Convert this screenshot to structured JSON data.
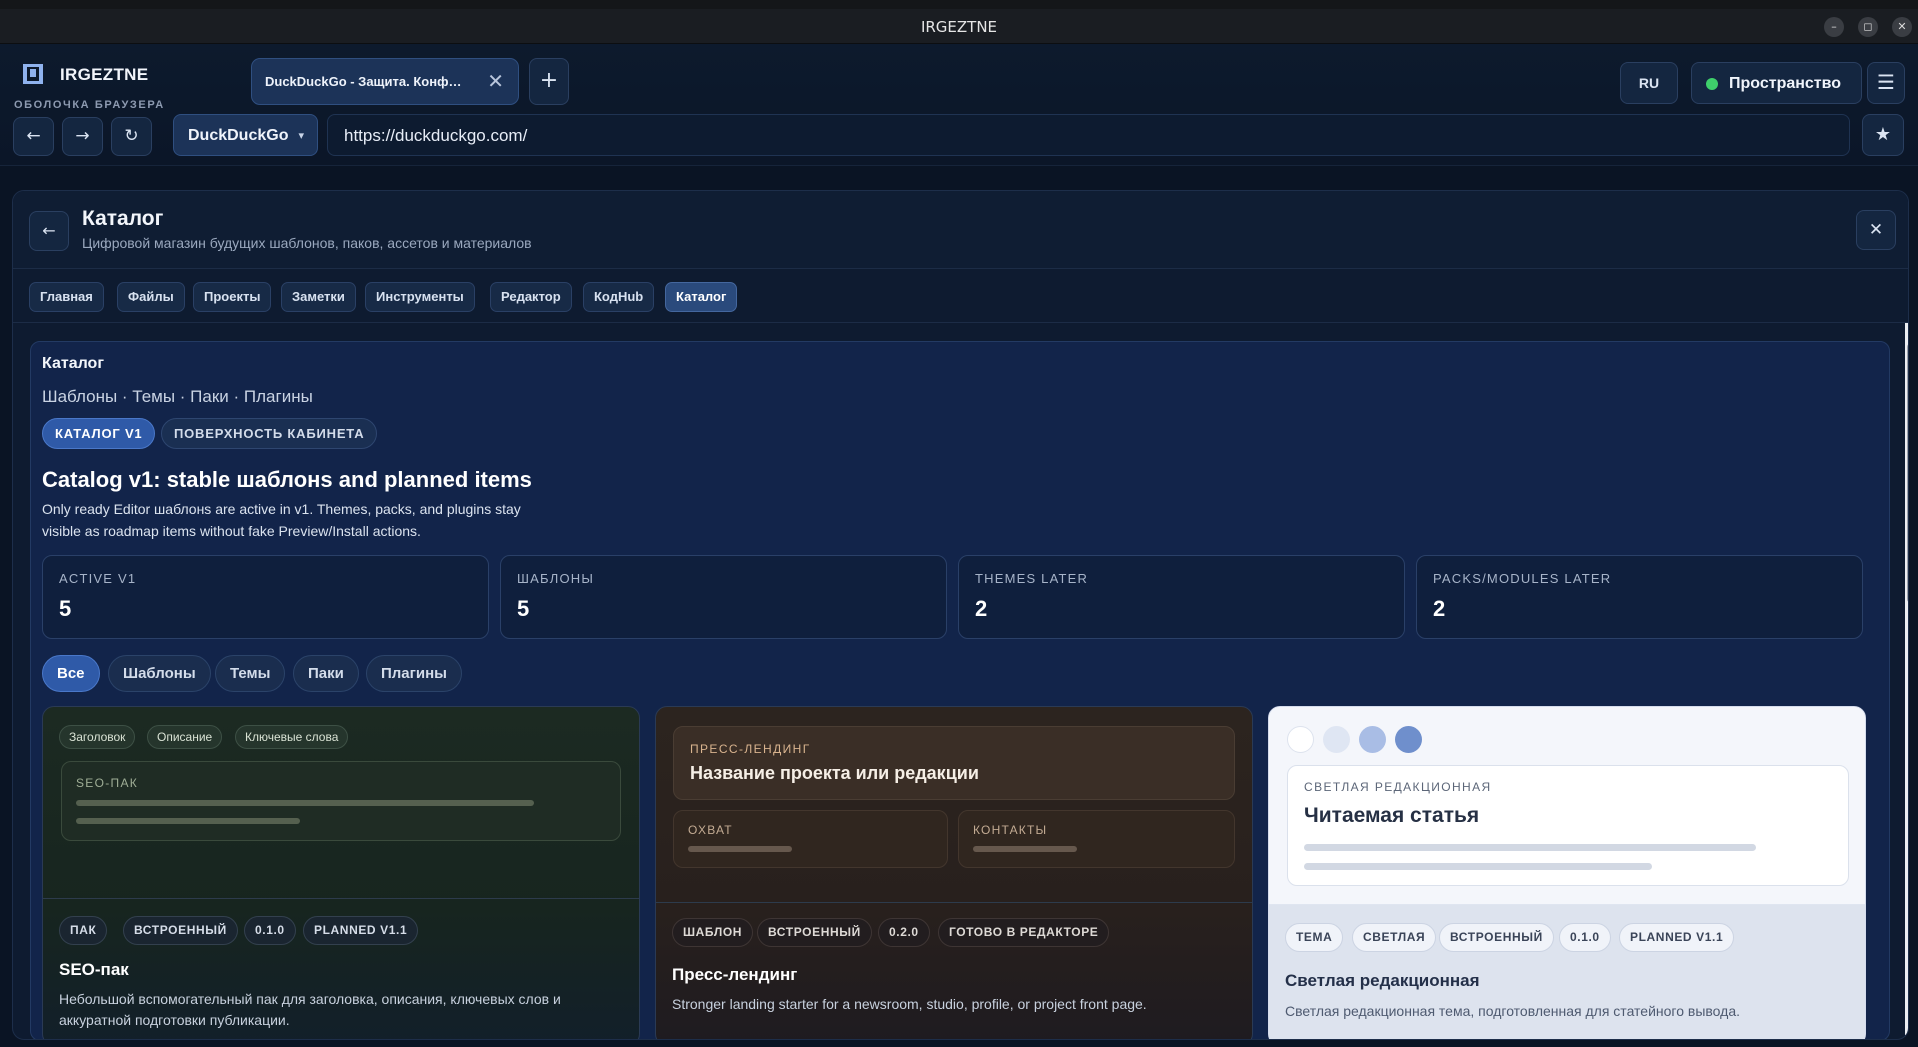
{
  "os": {
    "title": "IRGEZTNE",
    "minimize": "–",
    "maximize": "◻",
    "close": "✕"
  },
  "brand": {
    "name": "IRGEZTNE",
    "subtitle": "ОБОЛОЧКА БРАУЗЕРА"
  },
  "tabs": [
    {
      "label": "DuckDuckGo - Защита. Конф…",
      "close": "✕"
    }
  ],
  "new_tab": "+",
  "toolbar": {
    "lang": "RU",
    "space": "Пространство",
    "menu": "☰",
    "back": "←",
    "forward": "→",
    "reload": "↻",
    "engine": "DuckDuckGo",
    "engine_caret": "▾",
    "url": "https://duckduckgo.com/",
    "bookmark": "★"
  },
  "colors": {
    "accent": "#2f5aa8",
    "status_online": "#3ecf6b",
    "panel_bg": "#0e1b30"
  },
  "panel": {
    "back": "←",
    "title": "Каталог",
    "subtitle": "Цифровой магазин будущих шаблонов, паков, ассетов и материалов",
    "close": "✕",
    "nav": [
      "Главная",
      "Файлы",
      "Проекты",
      "Заметки",
      "Инструменты",
      "Редактор",
      "КодHub",
      "Каталог"
    ],
    "nav_active": "Каталог"
  },
  "catalog": {
    "title": "Каталог",
    "crumbs": "Шаблоны · Темы · Паки · Плагины",
    "chip_primary": "КАТАЛОГ V1",
    "chip_secondary": "ПОВЕРХНОСТЬ КАБИНЕТА",
    "heading": "Catalog v1: stable шаблонs and planned items",
    "description": "Only ready Editor шаблонs are active in v1. Themes, packs, and plugins stay visible as roadmap items without fake Preview/Install actions.",
    "stats": [
      {
        "label": "ACTIVE V1",
        "value": "5"
      },
      {
        "label": "ШАБЛОНЫ",
        "value": "5"
      },
      {
        "label": "THEMES LATER",
        "value": "2"
      },
      {
        "label": "PACKS/MODULES LATER",
        "value": "2"
      }
    ],
    "filters": [
      "Все",
      "Шаблоны",
      "Темы",
      "Паки",
      "Плагины"
    ],
    "filter_active": "Все",
    "cards": [
      {
        "preview_tags": [
          "Заголовок",
          "Описание",
          "Ключевые слова"
        ],
        "preview_label": "SEO-ПАК",
        "tags": [
          "ПАК",
          "ВСТРОЕННЫЙ",
          "0.1.0",
          "PLANNED V1.1"
        ],
        "name": "SEO-пак",
        "description": "Небольшой вспомогательный пак для заголовка, описания, ключевых слов и аккуратной подготовки публикации."
      },
      {
        "preview_kicker": "ПРЕСС-ЛЕНДИНГ",
        "preview_title": "Название проекта или редакции",
        "preview_boxes": [
          "ОХВАТ",
          "КОНТАКТЫ"
        ],
        "tags": [
          "ШАБЛОН",
          "ВСТРОЕННЫЙ",
          "0.2.0",
          "ГОТОВО В РЕДАКТОРЕ"
        ],
        "name": "Пресс-лендинг",
        "description": "Stronger landing starter for a newsroom, studio, profile, or project front page."
      },
      {
        "swatches": [
          "#ffffff",
          "#dfe6f3",
          "#a9bde5",
          "#6f8fcc"
        ],
        "preview_kicker": "СВЕТЛАЯ РЕДАКЦИОННАЯ",
        "preview_title": "Читаемая статья",
        "tags": [
          "ТЕМА",
          "СВЕТЛАЯ",
          "ВСТРОЕННЫЙ",
          "0.1.0",
          "PLANNED V1.1"
        ],
        "name": "Светлая редакционная",
        "description": "Светлая редакционная тема, подготовленная для статейного вывода."
      }
    ]
  },
  "scroll": {
    "up": "▲",
    "down": "▼"
  }
}
